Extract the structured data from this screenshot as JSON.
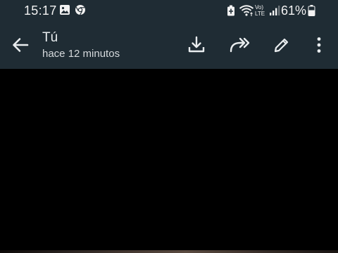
{
  "status_bar": {
    "time": "15:17",
    "left_icons": [
      "gallery-icon",
      "chrome-icon"
    ],
    "right_icons": [
      "battery-saver-icon",
      "wifi-icon",
      "volte-icon",
      "signal-icon",
      "battery-icon"
    ],
    "volte_label_top": "Vo)",
    "volte_label_bottom": "LTE",
    "battery_percent": "61%"
  },
  "header": {
    "title": "Tú",
    "subtitle": "hace 12 minutos",
    "actions": [
      "download-icon",
      "forward-icon",
      "edit-icon",
      "more-options-icon"
    ]
  },
  "colors": {
    "bar_background": "#1f2c34",
    "media_background": "#000000",
    "text_primary": "#e9edef"
  }
}
